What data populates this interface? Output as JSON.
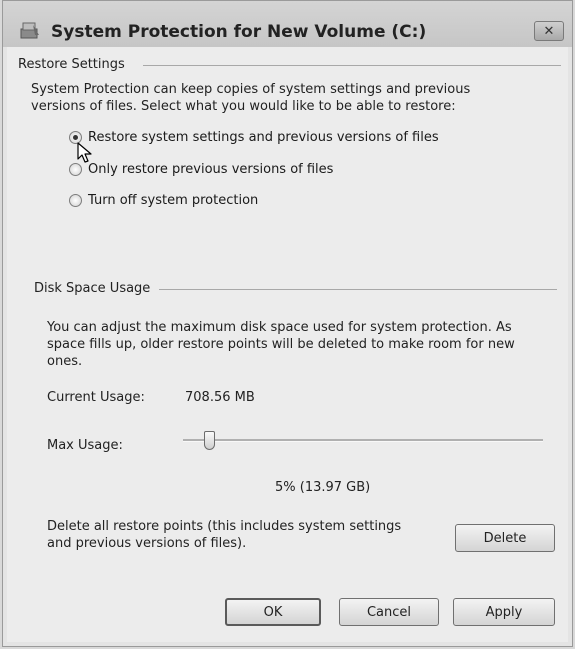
{
  "window": {
    "title": "System Protection for New Volume (C:)",
    "close_label": "✕"
  },
  "restore_settings": {
    "header": "Restore Settings",
    "description_line1": "System Protection can keep copies of system settings and previous",
    "description_line2": "versions of files. Select what you would like to be able to restore:",
    "options": [
      {
        "label": "Restore system settings and previous versions of files",
        "selected": true
      },
      {
        "label": "Only restore previous versions of files",
        "selected": false
      },
      {
        "label": "Turn off system protection",
        "selected": false
      }
    ]
  },
  "disk_space": {
    "header": "Disk Space Usage",
    "description_line1": "You can adjust the maximum disk space used for system protection. As",
    "description_line2": "space fills up, older restore points will be deleted to make room for new",
    "description_line3": "ones.",
    "current_usage_label": "Current Usage:",
    "current_usage_value": "708.56 MB",
    "max_usage_label": "Max Usage:",
    "max_usage_value": "5% (13.97 GB)",
    "max_usage_fraction": 0.05,
    "delete_text_line1": "Delete all restore points (this includes system settings",
    "delete_text_line2": "and previous versions of files).",
    "delete_label": "Delete"
  },
  "footer": {
    "ok_label": "OK",
    "cancel_label": "Cancel",
    "apply_label": "Apply"
  },
  "icons": {
    "app": "system-protection-icon",
    "close": "close-icon",
    "cursor": "mouse-pointer-icon"
  }
}
